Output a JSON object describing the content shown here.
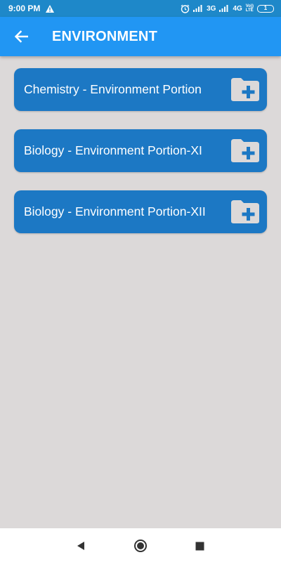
{
  "status_bar": {
    "time": "9:00 PM",
    "net1": "3G",
    "net2": "4G",
    "volte_top": "Vo))",
    "volte_bottom": "LTE",
    "battery": "1"
  },
  "app_bar": {
    "title": "ENVIRONMENT"
  },
  "items": [
    {
      "label": "Chemistry - Environment Portion",
      "icon": "folder-add-icon"
    },
    {
      "label": "Biology - Environment Portion-XI",
      "icon": "folder-add-icon"
    },
    {
      "label": "Biology - Environment Portion-XII",
      "icon": "folder-add-icon"
    }
  ],
  "colors": {
    "status_bar": "#1e88c9",
    "app_bar": "#2196f3",
    "card": "#1c78c4",
    "background": "#dcd9d9",
    "folder_icon": "#dcd9d9"
  }
}
